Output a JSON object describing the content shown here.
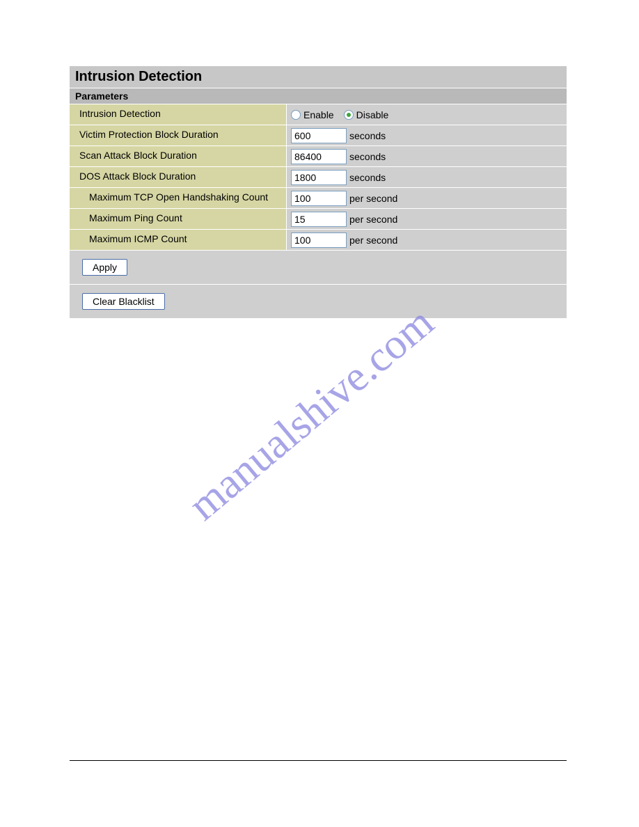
{
  "title": "Intrusion Detection",
  "section": "Parameters",
  "rows": {
    "intrusionDetection": {
      "label": "Intrusion Detection",
      "options": {
        "enable": "Enable",
        "disable": "Disable"
      },
      "selected": "disable"
    },
    "victimProtection": {
      "label": "Victim Protection Block Duration",
      "value": "600",
      "unit": "seconds"
    },
    "scanAttack": {
      "label": "Scan Attack Block Duration",
      "value": "86400",
      "unit": "seconds"
    },
    "dosAttack": {
      "label": "DOS Attack Block Duration",
      "value": "1800",
      "unit": "seconds"
    },
    "maxTcp": {
      "label": "Maximum TCP Open Handshaking Count",
      "value": "100",
      "unit": "per second"
    },
    "maxPing": {
      "label": "Maximum Ping Count",
      "value": "15",
      "unit": "per second"
    },
    "maxIcmp": {
      "label": "Maximum ICMP Count",
      "value": "100",
      "unit": "per second"
    }
  },
  "buttons": {
    "apply": "Apply",
    "clearBlacklist": "Clear Blacklist"
  },
  "watermark": "manualshive.com"
}
